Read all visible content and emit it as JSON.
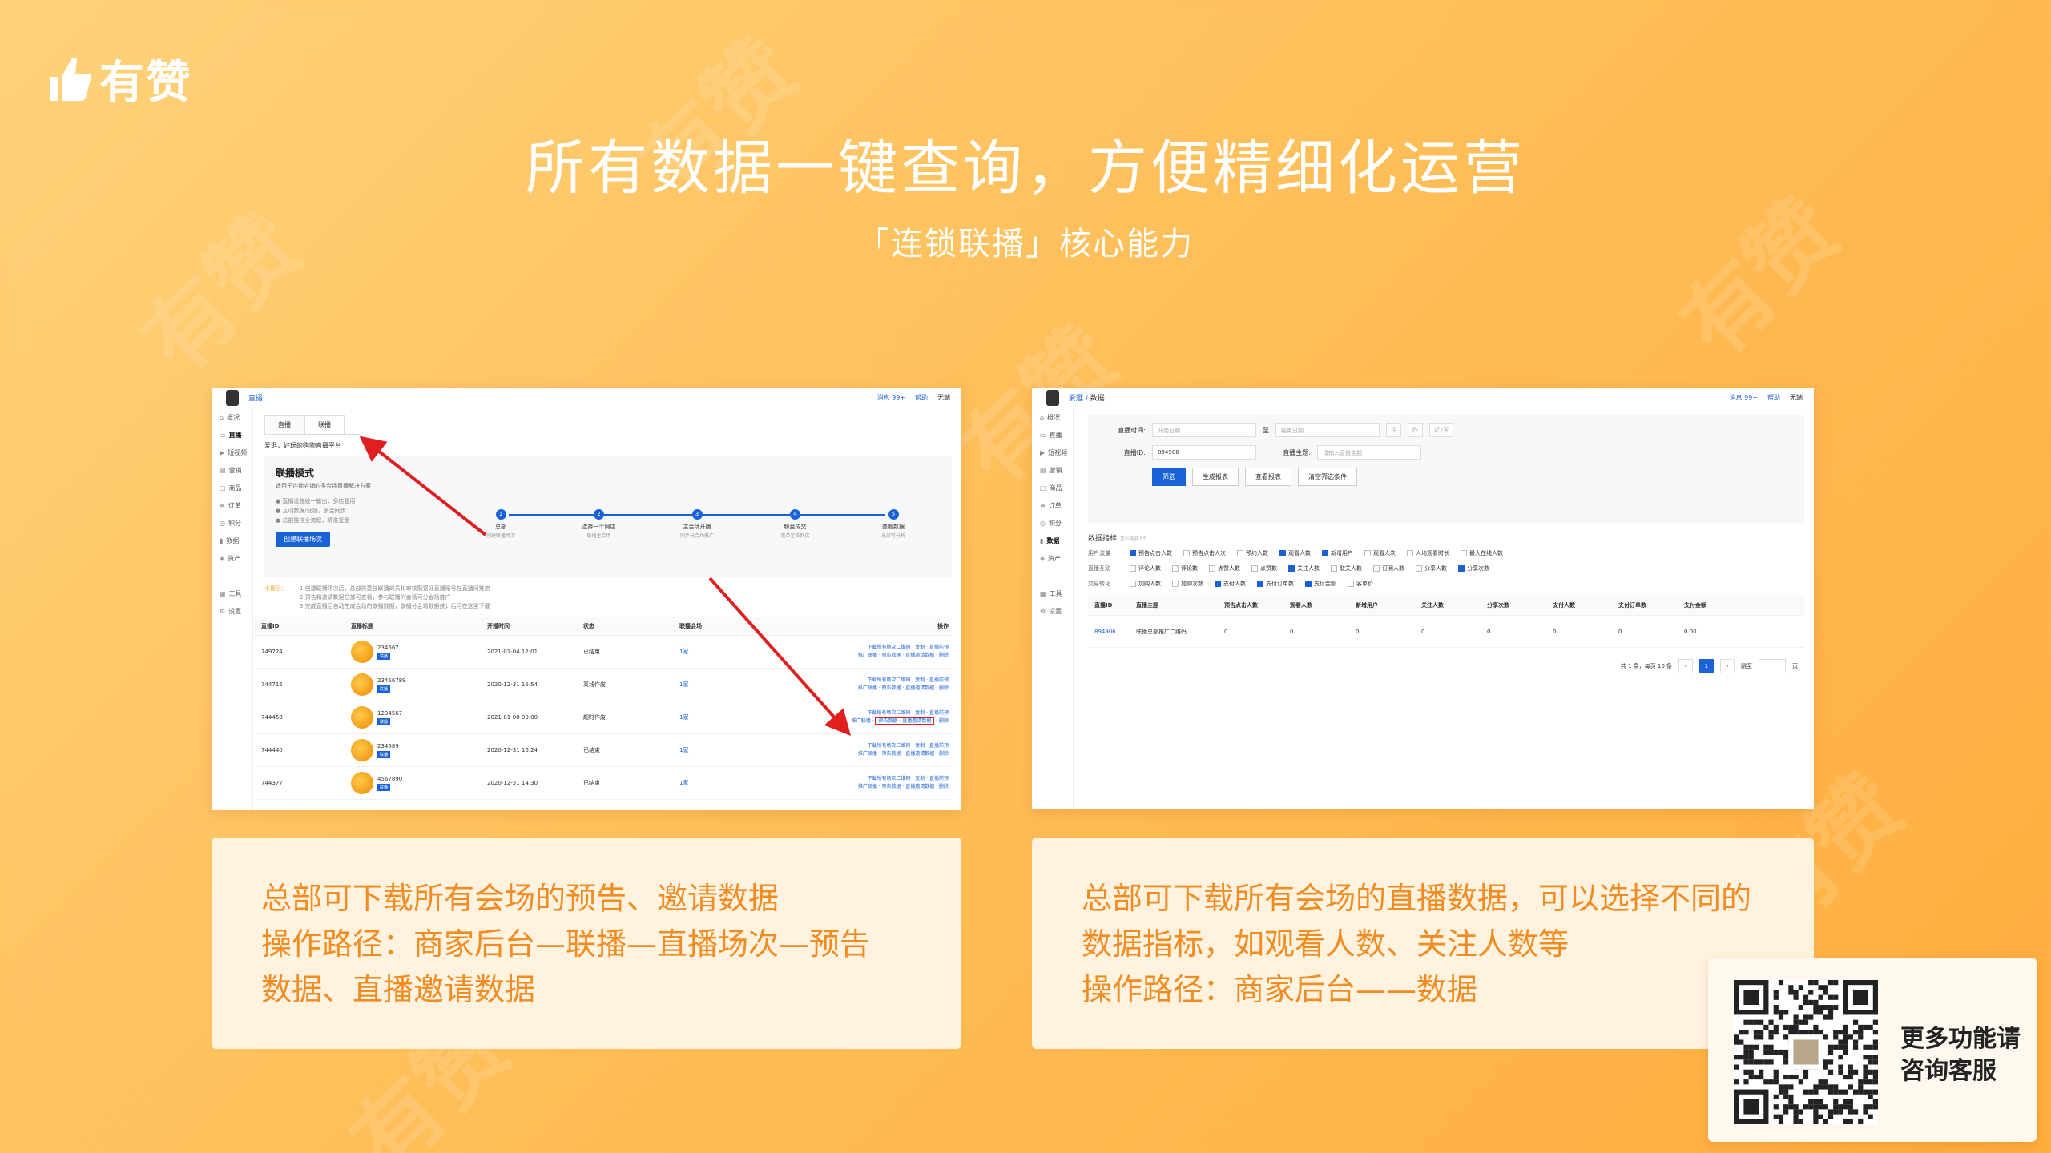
{
  "brand": {
    "logo_text": "有赞",
    "watermark_text": "有赞"
  },
  "headline": "所有数据一键查询，方便精细化运营",
  "subline": "「连锁联播」核心能力",
  "shot1": {
    "crumb": "直播",
    "top_right": [
      "消息 99+",
      "帮助",
      "无端"
    ],
    "side": [
      {
        "icon": "⌂",
        "label": "概况"
      },
      {
        "icon": "▭",
        "label": "直播"
      },
      {
        "icon": "▶",
        "label": "短视频"
      },
      {
        "icon": "▤",
        "label": "营销"
      },
      {
        "icon": "▢",
        "label": "商品"
      },
      {
        "icon": "≡",
        "label": "订单"
      },
      {
        "icon": "◎",
        "label": "积分"
      },
      {
        "icon": "▮",
        "label": "数据"
      },
      {
        "icon": "◈",
        "label": "资产"
      },
      {
        "icon": "▦",
        "label": "工具"
      },
      {
        "icon": "⚙",
        "label": "设置"
      }
    ],
    "tabs": [
      "直播",
      "联播"
    ],
    "desc": "爱逛，好玩的购物直播平台",
    "mode": {
      "title": "联播模式",
      "sub": "适用于连锁店铺的多会场直播解决方案",
      "bullets": [
        "直播设施统一输出，多店复用",
        "互动数据/营销，多会同步",
        "总部监控全流程，精准复盘"
      ],
      "button": "创建联播场次"
    },
    "steps": [
      {
        "n": "1",
        "t": "总部",
        "d": "创建联播场次"
      },
      {
        "n": "2",
        "t": "选择一个网店",
        "d": "联播主会场"
      },
      {
        "n": "3",
        "t": "主会场开播",
        "d": "同步分会场推广"
      },
      {
        "n": "4",
        "t": "粉丝成交",
        "d": "落单至各网店"
      },
      {
        "n": "5",
        "t": "查看数据",
        "d": "总部可分析"
      }
    ],
    "tip": {
      "label": "小提示：",
      "lines": [
        "1.创建联播场次后，总部先委任联播的员和审核配置好直播账号在直播间推流",
        "2.预告和邀请数据总部可查看，参与联播的会场可分会场推广",
        "3.完成直播后自动生成会场的联播数据，联播分会场数据统计后可在这里下载"
      ]
    },
    "table": {
      "headers": [
        "直播ID",
        "直播标题",
        "开播时间",
        "状态",
        "联播会场",
        "操作"
      ],
      "rows": [
        {
          "id": "749724",
          "title": "234567",
          "badge": "联播",
          "time": "2021-01-04 12:01",
          "status": "已结束",
          "venue": "1家",
          "ops1": "下载所有场次二维码 · 复制 · 直播前预",
          "ops2": "推广联播 · 预告数据 · 直播邀请数据 · 删除"
        },
        {
          "id": "744716",
          "title": "23456789",
          "badge": "联播",
          "time": "2020-12-31 15:54",
          "status": "离线作废",
          "venue": "1家",
          "ops1": "下载所有场次二维码 · 复制 · 直播前预",
          "ops2": "推广联播 · 预告数据 · 直播邀请数据 · 删除"
        },
        {
          "id": "744458",
          "title": "1234567",
          "badge": "联播",
          "time": "2021-01-08 00:00",
          "status": "超时作废",
          "venue": "1家",
          "ops1": "下载所有场次二维码 · 复制 · 直播前预",
          "ops2a": "推广联播 ·",
          "ops2b": "预告数据",
          "ops2c": "直播邀请数据",
          "ops2d": "· 删除"
        },
        {
          "id": "744440",
          "title": "234589",
          "badge": "联播",
          "time": "2020-12-31 16:24",
          "status": "已结束",
          "venue": "1家",
          "ops1": "下载所有场次二维码 · 复制 · 直播前预",
          "ops2": "推广联播 · 预告数据 · 直播邀请数据 · 删除"
        },
        {
          "id": "744377",
          "title": "4567890",
          "badge": "联播",
          "time": "2020-12-31 14:30",
          "status": "已结束",
          "venue": "1家",
          "ops1": "下载所有场次二维码 · 复制 · 直播前预",
          "ops2": "推广联播 · 预告数据 · 直播邀请数据 · 删除"
        }
      ]
    }
  },
  "shot2": {
    "crumb": "爱逛",
    "crumb2": "数据",
    "top_right": [
      "消息 99+",
      "帮助",
      "无端"
    ],
    "side": [
      {
        "icon": "⌂",
        "label": "概况"
      },
      {
        "icon": "▭",
        "label": "直播"
      },
      {
        "icon": "▶",
        "label": "短视频"
      },
      {
        "icon": "▤",
        "label": "营销"
      },
      {
        "icon": "▢",
        "label": "商品"
      },
      {
        "icon": "≡",
        "label": "订单"
      },
      {
        "icon": "◎",
        "label": "积分"
      },
      {
        "icon": "▮",
        "label": "数据"
      },
      {
        "icon": "◈",
        "label": "资产"
      },
      {
        "icon": "▦",
        "label": "工具"
      },
      {
        "icon": "⚙",
        "label": "设置"
      }
    ],
    "filter": {
      "time_label": "直播时间:",
      "start_ph": "开始日期",
      "to": "至",
      "end_ph": "结束日期",
      "quick": [
        "今",
        "昨",
        "近7天"
      ],
      "id_label": "直播ID:",
      "id_value": "894906",
      "theme_label": "直播主题:",
      "theme_ph": "请输入直播主题",
      "buttons": [
        "筛选",
        "生成报表",
        "查看报表",
        "清空筛选条件"
      ]
    },
    "metrics": {
      "title": "数据指标",
      "hint": "至少选择1个",
      "groups": [
        {
          "name": "用户流量",
          "items": [
            [
              "预告点击人数",
              true
            ],
            [
              "预告点击人次",
              false
            ],
            [
              "预约人数",
              false
            ],
            [
              "观看人数",
              true
            ],
            [
              "新增用户",
              true
            ],
            [
              "观看人次",
              false
            ],
            [
              "人均观看时长",
              false
            ],
            [
              "最大在线人数",
              false
            ]
          ]
        },
        {
          "name": "直播互动",
          "items": [
            [
              "评论人数",
              false
            ],
            [
              "评论数",
              false
            ],
            [
              "点赞人数",
              false
            ],
            [
              "点赞数",
              false
            ],
            [
              "关注人数",
              true
            ],
            [
              "取关人数",
              false
            ],
            [
              "订阅人数",
              false
            ],
            [
              "分享人数",
              false
            ],
            [
              "分享次数",
              true
            ]
          ]
        },
        {
          "name": "交易转化",
          "items": [
            [
              "加购人数",
              false
            ],
            [
              "加购次数",
              false
            ],
            [
              "支付人数",
              true
            ],
            [
              "支付订单数",
              true
            ],
            [
              "支付金额",
              true
            ],
            [
              "客单价",
              false
            ]
          ]
        }
      ]
    },
    "table": {
      "headers": [
        "直播ID",
        "直播主题",
        "预告点击人数",
        "观看人数",
        "新增用户",
        "关注人数",
        "分享次数",
        "支付人数",
        "支付订单数",
        "支付金额"
      ],
      "row": [
        "894906",
        "联播总部推广二维码",
        "0",
        "0",
        "0",
        "0",
        "0",
        "0",
        "0",
        "0.00"
      ]
    },
    "pager": {
      "summary": "共 1 条，每页 10 条",
      "page": "1",
      "goto": "跳至",
      "unit": "页"
    }
  },
  "captions": {
    "left": [
      "总部可下载所有会场的预告、邀请数据",
      "操作路径：商家后台—联播—直播场次—预告",
      "数据、直播邀请数据"
    ],
    "right": [
      "总部可下载所有会场的直播数据，可以选择不同的",
      "数据指标，如观看人数、关注人数等",
      "操作路径：商家后台——数据"
    ]
  },
  "qr": {
    "text_1": "更多功能请",
    "text_2": "咨询客服"
  },
  "colors": {
    "accent": "#1a63d6",
    "caption": "#f08c21",
    "arrow": "#e02020",
    "bg": "#ffbf5a"
  }
}
